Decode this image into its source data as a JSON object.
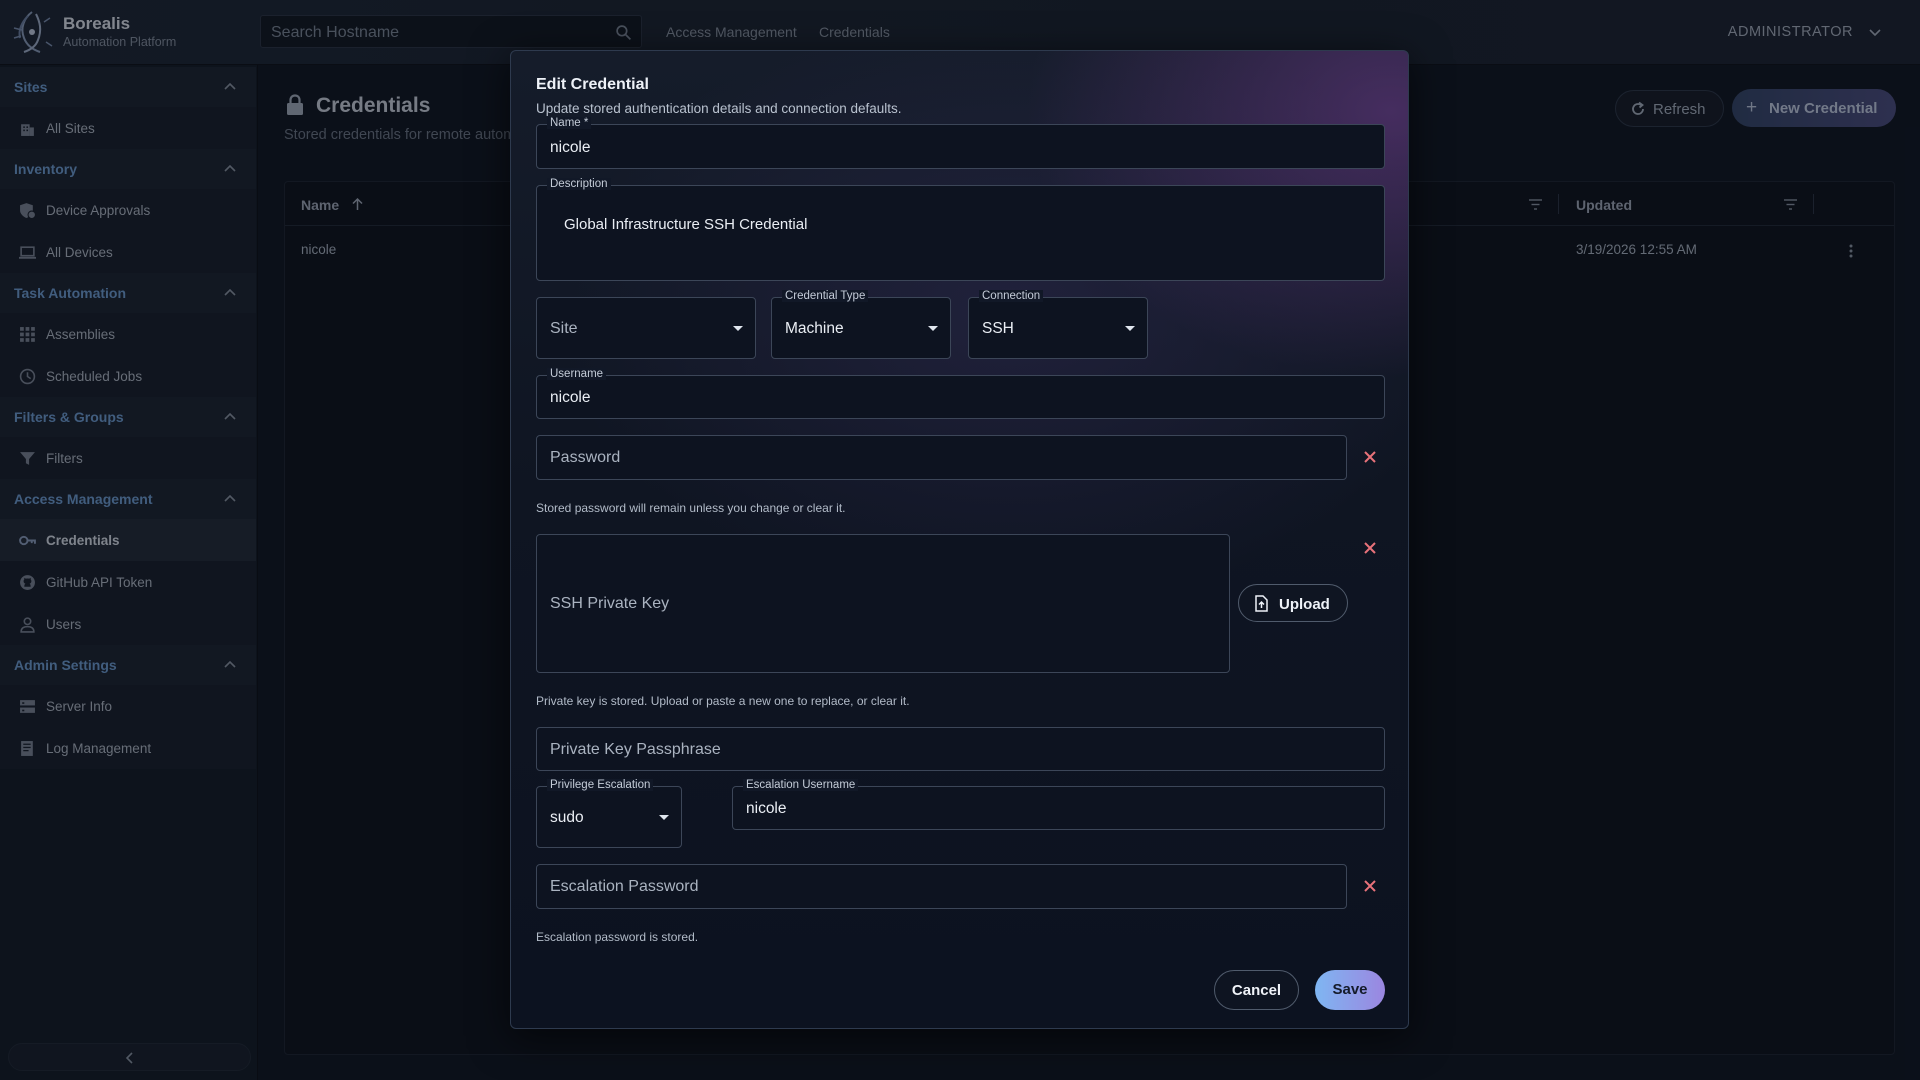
{
  "app": {
    "brand_name": "Borealis",
    "brand_sub": "Automation Platform",
    "search_placeholder": "Search Hostname",
    "breadcrumbs": [
      "Access Management",
      "Credentials"
    ],
    "user_menu": "ADMINISTRATOR"
  },
  "sidebar": {
    "sections": [
      {
        "title": "Sites",
        "items": [
          {
            "label": "All Sites",
            "icon": "building-icon"
          }
        ]
      },
      {
        "title": "Inventory",
        "items": [
          {
            "label": "Device Approvals",
            "icon": "shield-check-icon"
          },
          {
            "label": "All Devices",
            "icon": "laptop-icon"
          }
        ]
      },
      {
        "title": "Task Automation",
        "items": [
          {
            "label": "Assemblies",
            "icon": "grid-icon"
          },
          {
            "label": "Scheduled Jobs",
            "icon": "clock-icon"
          }
        ]
      },
      {
        "title": "Filters & Groups",
        "items": [
          {
            "label": "Filters",
            "icon": "filter-icon"
          }
        ]
      },
      {
        "title": "Access Management",
        "items": [
          {
            "label": "Credentials",
            "icon": "key-icon",
            "active": true
          },
          {
            "label": "GitHub API Token",
            "icon": "github-icon"
          },
          {
            "label": "Users",
            "icon": "user-icon"
          }
        ]
      },
      {
        "title": "Admin Settings",
        "items": [
          {
            "label": "Server Info",
            "icon": "server-icon"
          },
          {
            "label": "Log Management",
            "icon": "log-icon"
          }
        ]
      }
    ]
  },
  "page": {
    "title": "Credentials",
    "subtitle": "Stored credentials for remote autom",
    "refresh_label": "Refresh",
    "new_label": "New Credential",
    "table": {
      "columns": [
        "Name",
        "Updated"
      ],
      "rows": [
        {
          "name": "nicole",
          "updated": "3/19/2026 12:55 AM"
        }
      ]
    }
  },
  "dialog": {
    "title": "Edit Credential",
    "subtitle": "Update stored authentication details and connection defaults.",
    "name_label": "Name *",
    "name_value": "nicole",
    "description_label": "Description",
    "description_value": "Global Infrastructure SSH Credential",
    "site_placeholder": "Site",
    "credential_type_label": "Credential Type",
    "credential_type_value": "Machine",
    "connection_label": "Connection",
    "connection_value": "SSH",
    "username_label": "Username",
    "username_value": "nicole",
    "password_placeholder": "Password",
    "password_helper": "Stored password will remain unless you change or clear it.",
    "ssh_key_placeholder": "SSH Private Key",
    "upload_label": "Upload",
    "ssh_key_helper": "Private key is stored. Upload or paste a new one to replace, or clear it.",
    "passphrase_placeholder": "Private Key Passphrase",
    "priv_esc_label": "Privilege Escalation",
    "priv_esc_value": "sudo",
    "esc_username_label": "Escalation Username",
    "esc_username_value": "nicole",
    "esc_password_placeholder": "Escalation Password",
    "esc_password_helper": "Escalation password is stored.",
    "cancel_label": "Cancel",
    "save_label": "Save"
  },
  "colors": {
    "accent": "#6fa0d8",
    "clear_icon": "#e8727a",
    "save_gradient_start": "#7fb6f2",
    "save_gradient_end": "#9b86e0"
  }
}
